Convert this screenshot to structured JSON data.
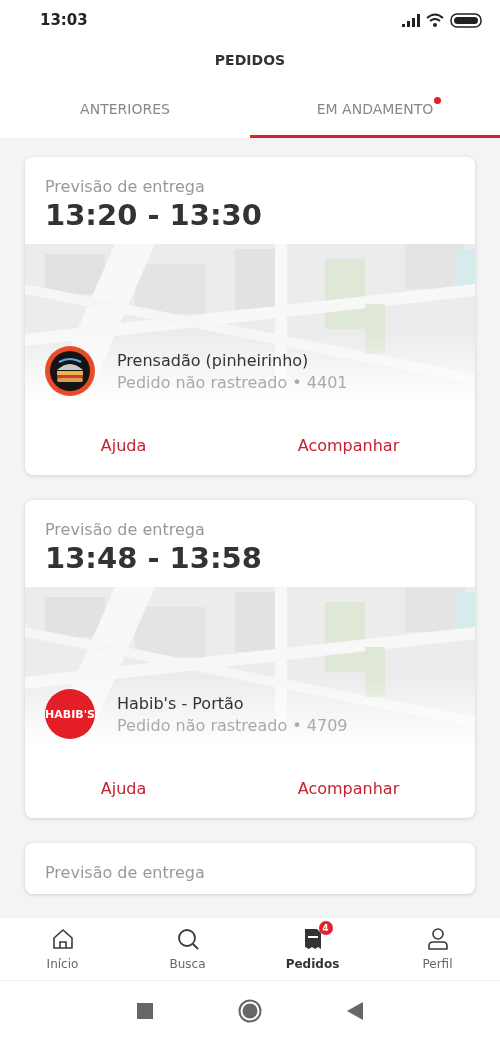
{
  "status_bar": {
    "time": "13:03"
  },
  "header": {
    "title": "PEDIDOS"
  },
  "tabs": [
    {
      "label": "ANTERIORES",
      "selected": false,
      "dot": false
    },
    {
      "label": "EM ANDAMENTO",
      "selected": true,
      "dot": true
    }
  ],
  "orders": [
    {
      "eta_label": "Previsão de entrega",
      "eta": "13:20 - 13:30",
      "restaurant": "Prensadão (pinheirinho)",
      "status": "Pedido não rastreado • 4401",
      "logo": {
        "kind": "sandwich"
      },
      "actions": [
        "Ajuda",
        "Acompanhar"
      ]
    },
    {
      "eta_label": "Previsão de entrega",
      "eta": "13:48 - 13:58",
      "restaurant": "Habib's - Portão",
      "status": "Pedido não rastreado • 4709",
      "logo": {
        "kind": "text",
        "text": "HABIB'S"
      },
      "actions": [
        "Ajuda",
        "Acompanhar"
      ]
    },
    {
      "eta_label": "Previsão de entrega"
    }
  ],
  "bottom_nav": [
    {
      "kind": "home",
      "label": "Início",
      "selected": false
    },
    {
      "kind": "search",
      "label": "Busca",
      "selected": false
    },
    {
      "kind": "orders",
      "label": "Pedidos",
      "selected": true,
      "badge": "4"
    },
    {
      "kind": "profile",
      "label": "Perfil",
      "selected": false
    }
  ]
}
